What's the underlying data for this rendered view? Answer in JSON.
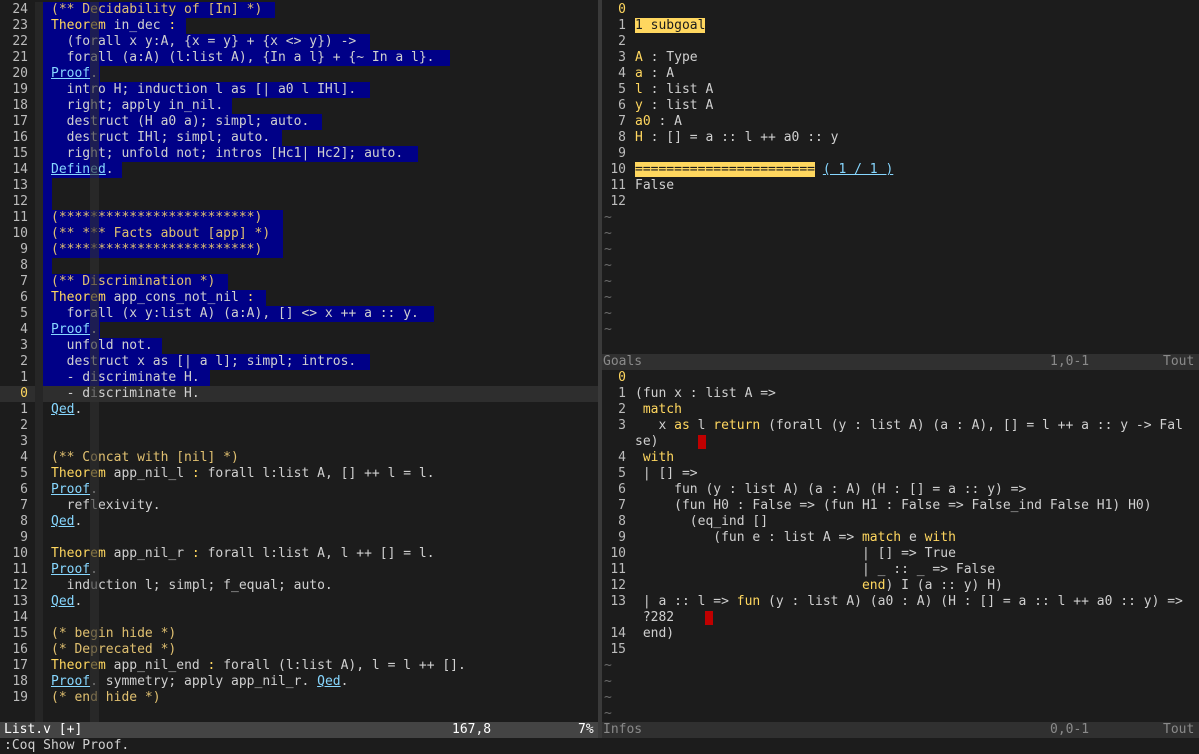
{
  "left": {
    "lines": [
      {
        "n": "24",
        "segs": [
          {
            "t": "(** Decidability of [In] *)",
            "c": "c"
          }
        ],
        "sel": [
          43,
          275
        ]
      },
      {
        "n": "23",
        "segs": [
          {
            "t": "Theorem ",
            "c": "k"
          },
          {
            "t": "in_dec",
            "c": "t"
          },
          {
            "t": " :",
            "c": "k"
          }
        ],
        "sel": [
          43,
          186
        ]
      },
      {
        "n": "22",
        "segs": [
          {
            "t": "  (forall x y:A, {x = y} + {x <> y}) ->",
            "c": "t"
          }
        ],
        "sel": [
          43,
          370
        ]
      },
      {
        "n": "21",
        "segs": [
          {
            "t": "  forall (a:A) (l:list A), {In a l} + {~ In a l}.",
            "c": "t"
          }
        ],
        "sel": [
          43,
          450
        ]
      },
      {
        "n": "20",
        "segs": [
          {
            "t": "Proof",
            "c": "pf"
          },
          {
            "t": ".",
            "c": "t"
          }
        ],
        "sel": [
          43,
          100
        ]
      },
      {
        "n": "19",
        "segs": [
          {
            "t": "  intro H; induction l as [| a0 l IHl].",
            "c": "t"
          }
        ],
        "sel": [
          43,
          370
        ]
      },
      {
        "n": "18",
        "segs": [
          {
            "t": "  right; apply in_nil.",
            "c": "t"
          }
        ],
        "sel": [
          43,
          232
        ]
      },
      {
        "n": "17",
        "segs": [
          {
            "t": "  destruct (H a0 a); simpl; auto.",
            "c": "t"
          }
        ],
        "sel": [
          43,
          322
        ]
      },
      {
        "n": "16",
        "segs": [
          {
            "t": "  destruct IHl; simpl; auto.",
            "c": "t"
          }
        ],
        "sel": [
          43,
          282
        ]
      },
      {
        "n": "15",
        "segs": [
          {
            "t": "  right; unfold not; intros [Hc1| Hc2]; auto.",
            "c": "t"
          }
        ],
        "sel": [
          43,
          418
        ]
      },
      {
        "n": "14",
        "segs": [
          {
            "t": "Defined",
            "c": "pf"
          },
          {
            "t": ".",
            "c": "t"
          }
        ],
        "sel": [
          43,
          122
        ]
      },
      {
        "n": "13",
        "segs": [],
        "sel": [
          43,
          52
        ]
      },
      {
        "n": "12",
        "segs": [],
        "sel": [
          43,
          52
        ]
      },
      {
        "n": "11",
        "segs": [
          {
            "t": "(*************************)",
            "c": "c"
          }
        ],
        "sel": [
          43,
          283
        ]
      },
      {
        "n": "10",
        "segs": [
          {
            "t": "(** *** Facts about [app] *)",
            "c": "c"
          }
        ],
        "sel": [
          43,
          283
        ]
      },
      {
        "n": "9",
        "segs": [
          {
            "t": "(*************************)",
            "c": "c"
          }
        ],
        "sel": [
          43,
          283
        ]
      },
      {
        "n": "8",
        "segs": [],
        "sel": [
          43,
          52
        ]
      },
      {
        "n": "7",
        "segs": [
          {
            "t": "(** Discrimination *)",
            "c": "c"
          }
        ],
        "sel": [
          43,
          228
        ]
      },
      {
        "n": "6",
        "segs": [
          {
            "t": "Theorem ",
            "c": "k"
          },
          {
            "t": "app_cons_not_nil",
            "c": "t"
          },
          {
            "t": " :",
            "c": "k"
          }
        ],
        "sel": [
          43,
          266
        ]
      },
      {
        "n": "5",
        "segs": [
          {
            "t": "  forall (x y:list A) (a:A), [] <> x ++ a :: y.",
            "c": "t"
          }
        ],
        "sel": [
          43,
          434
        ]
      },
      {
        "n": "4",
        "segs": [
          {
            "t": "Proof",
            "c": "pf"
          },
          {
            "t": ".",
            "c": "t"
          }
        ],
        "sel": [
          43,
          100
        ]
      },
      {
        "n": "3",
        "segs": [
          {
            "t": "  unfold not.",
            "c": "t"
          }
        ],
        "sel": [
          43,
          162
        ]
      },
      {
        "n": "2",
        "segs": [
          {
            "t": "  destruct x as [| a l]; simpl; intros.",
            "c": "t"
          }
        ],
        "sel": [
          43,
          370
        ]
      },
      {
        "n": "1",
        "segs": [
          {
            "t": "  - discriminate H.",
            "c": "t"
          }
        ],
        "sel": [
          43,
          210
        ]
      },
      {
        "n": "0",
        "segs": [
          {
            "t": "  - discriminate H.",
            "c": "t"
          }
        ],
        "cur": true
      },
      {
        "n": "1",
        "segs": [
          {
            "t": "Qed",
            "c": "pf"
          },
          {
            "t": ".",
            "c": "t"
          }
        ]
      },
      {
        "n": "2",
        "segs": []
      },
      {
        "n": "3",
        "segs": []
      },
      {
        "n": "4",
        "segs": [
          {
            "t": "(** Concat with [nil] *)",
            "c": "c"
          }
        ]
      },
      {
        "n": "5",
        "segs": [
          {
            "t": "Theorem ",
            "c": "k"
          },
          {
            "t": "app_nil_l",
            "c": "t"
          },
          {
            "t": " : ",
            "c": "k"
          },
          {
            "t": "forall l:list A, [] ++ l = l.",
            "c": "t"
          }
        ]
      },
      {
        "n": "6",
        "segs": [
          {
            "t": "Proof",
            "c": "pf"
          },
          {
            "t": ".",
            "c": "t"
          }
        ]
      },
      {
        "n": "7",
        "segs": [
          {
            "t": "  reflexivity.",
            "c": "t"
          }
        ]
      },
      {
        "n": "8",
        "segs": [
          {
            "t": "Qed",
            "c": "pf"
          },
          {
            "t": ".",
            "c": "t"
          }
        ]
      },
      {
        "n": "9",
        "segs": []
      },
      {
        "n": "10",
        "segs": [
          {
            "t": "Theorem ",
            "c": "k"
          },
          {
            "t": "app_nil_r",
            "c": "t"
          },
          {
            "t": " : ",
            "c": "k"
          },
          {
            "t": "forall l:list A, l ++ [] = l.",
            "c": "t"
          }
        ]
      },
      {
        "n": "11",
        "segs": [
          {
            "t": "Proof",
            "c": "pf"
          },
          {
            "t": ".",
            "c": "t"
          }
        ]
      },
      {
        "n": "12",
        "segs": [
          {
            "t": "  induction l; simpl; f_equal; auto.",
            "c": "t"
          }
        ]
      },
      {
        "n": "13",
        "segs": [
          {
            "t": "Qed",
            "c": "pf"
          },
          {
            "t": ".",
            "c": "t"
          }
        ]
      },
      {
        "n": "14",
        "segs": []
      },
      {
        "n": "15",
        "segs": [
          {
            "t": "(* begin hide *)",
            "c": "c"
          }
        ]
      },
      {
        "n": "16",
        "segs": [
          {
            "t": "(* Deprecated *)",
            "c": "c"
          }
        ]
      },
      {
        "n": "17",
        "segs": [
          {
            "t": "Theorem ",
            "c": "k"
          },
          {
            "t": "app_nil_end",
            "c": "t"
          },
          {
            "t": " : ",
            "c": "k"
          },
          {
            "t": "forall (l:list A), l = l ++ [].",
            "c": "t"
          }
        ]
      },
      {
        "n": "18",
        "segs": [
          {
            "t": "Proof",
            "c": "pf"
          },
          {
            "t": ". symmetry; apply app_nil_r. ",
            "c": "t"
          },
          {
            "t": "Qed",
            "c": "pf"
          },
          {
            "t": ".",
            "c": "t"
          }
        ]
      },
      {
        "n": "19",
        "segs": [
          {
            "t": "(* end hide *)",
            "c": "c"
          }
        ]
      }
    ]
  },
  "goals": {
    "lines": [
      {
        "n": "0",
        "segs": []
      },
      {
        "n": "1",
        "segs": [
          {
            "t": "1 subgoal",
            "c": "goalhl"
          }
        ]
      },
      {
        "n": "2",
        "segs": []
      },
      {
        "n": "3",
        "segs": [
          {
            "t": "A",
            "c": "k"
          },
          {
            "t": " : Type",
            "c": "t"
          }
        ]
      },
      {
        "n": "4",
        "segs": [
          {
            "t": "a",
            "c": "k"
          },
          {
            "t": " : A",
            "c": "t"
          }
        ]
      },
      {
        "n": "5",
        "segs": [
          {
            "t": "l",
            "c": "k"
          },
          {
            "t": " : list A",
            "c": "t"
          }
        ]
      },
      {
        "n": "6",
        "segs": [
          {
            "t": "y",
            "c": "k"
          },
          {
            "t": " : list A",
            "c": "t"
          }
        ]
      },
      {
        "n": "7",
        "segs": [
          {
            "t": "a0",
            "c": "k"
          },
          {
            "t": " : A",
            "c": "t"
          }
        ]
      },
      {
        "n": "8",
        "segs": [
          {
            "t": "H",
            "c": "k"
          },
          {
            "t": " : [] = a :: l ++ a0 :: y",
            "c": "t"
          }
        ]
      },
      {
        "n": "9",
        "segs": []
      },
      {
        "n": "10",
        "segs": [
          {
            "t": "=======================",
            "c": "goalhl"
          },
          {
            "t": " ",
            "c": "t"
          },
          {
            "t": "( 1 / 1 )",
            "c": "pf"
          }
        ]
      },
      {
        "n": "11",
        "segs": [
          {
            "t": "False",
            "c": "t"
          }
        ]
      },
      {
        "n": "12",
        "segs": []
      }
    ],
    "tildes": 8
  },
  "infos": {
    "lines": [
      {
        "n": "0",
        "segs": []
      },
      {
        "n": "1",
        "segs": [
          {
            "t": "(fun x : list A =>",
            "c": "t"
          }
        ]
      },
      {
        "n": "2",
        "segs": [
          {
            "t": " match",
            "c": "k"
          }
        ]
      },
      {
        "n": "3",
        "segs": [
          {
            "t": "   x ",
            "c": "t"
          },
          {
            "t": "as",
            "c": "k"
          },
          {
            "t": " l ",
            "c": "t"
          },
          {
            "t": "return",
            "c": "k"
          },
          {
            "t": " (forall (y : list A) (a : A), [] = l ++ a :: y -> Fal",
            "c": "t"
          }
        ]
      },
      {
        "n": "",
        "segs": [
          {
            "t": "se)     ",
            "c": "t"
          }
        ],
        "err": true
      },
      {
        "n": "4",
        "segs": [
          {
            "t": " with",
            "c": "k"
          }
        ]
      },
      {
        "n": "5",
        "segs": [
          {
            "t": " | [] =>",
            "c": "t"
          }
        ]
      },
      {
        "n": "6",
        "segs": [
          {
            "t": "     fun (y : list A) (a : A) (H : [] = a :: y) =>",
            "c": "t"
          }
        ]
      },
      {
        "n": "7",
        "segs": [
          {
            "t": "     (fun H0 : False => (fun H1 : False => False_ind False H1) H0)",
            "c": "t"
          }
        ]
      },
      {
        "n": "8",
        "segs": [
          {
            "t": "       (eq_ind []",
            "c": "t"
          }
        ]
      },
      {
        "n": "9",
        "segs": [
          {
            "t": "          (fun e : list A => ",
            "c": "t"
          },
          {
            "t": "match",
            "c": "k"
          },
          {
            "t": " e ",
            "c": "t"
          },
          {
            "t": "with",
            "c": "k"
          }
        ]
      },
      {
        "n": "10",
        "segs": [
          {
            "t": "                             | [] => True",
            "c": "t"
          }
        ]
      },
      {
        "n": "11",
        "segs": [
          {
            "t": "                             | _ :: _ => False",
            "c": "t"
          }
        ]
      },
      {
        "n": "12",
        "segs": [
          {
            "t": "                             ",
            "c": "t"
          },
          {
            "t": "end",
            "c": "k"
          },
          {
            "t": ") I (a :: y) H)",
            "c": "t"
          }
        ]
      },
      {
        "n": "13",
        "segs": [
          {
            "t": " | a :: l => ",
            "c": "t"
          },
          {
            "t": "fun",
            "c": "k"
          },
          {
            "t": " (y : list A) (a0 : A) (H : [] = a :: l ++ a0 :: y) =>",
            "c": "t"
          }
        ]
      },
      {
        "n": "",
        "segs": [
          {
            "t": " ?282    ",
            "c": "t"
          }
        ],
        "err": true
      },
      {
        "n": "14",
        "segs": [
          {
            "t": " end)",
            "c": "t"
          }
        ]
      },
      {
        "n": "15",
        "segs": []
      }
    ],
    "tildes": 4
  },
  "status": {
    "left_file": "List.v [+]",
    "left_pos": "167,8",
    "left_pct": "7%",
    "goals_name": "Goals",
    "goals_pos": "1,0-1",
    "goals_pct": "Tout",
    "infos_name": "Infos",
    "infos_pos": "0,0-1",
    "infos_pct": "Tout"
  },
  "cmdline": ":Coq Show Proof.",
  "colors": {
    "keyword": "#ffd75f",
    "comment": "#e0c070",
    "proof": "#87d7ff",
    "selection": "#000087",
    "error": "#c00000"
  }
}
